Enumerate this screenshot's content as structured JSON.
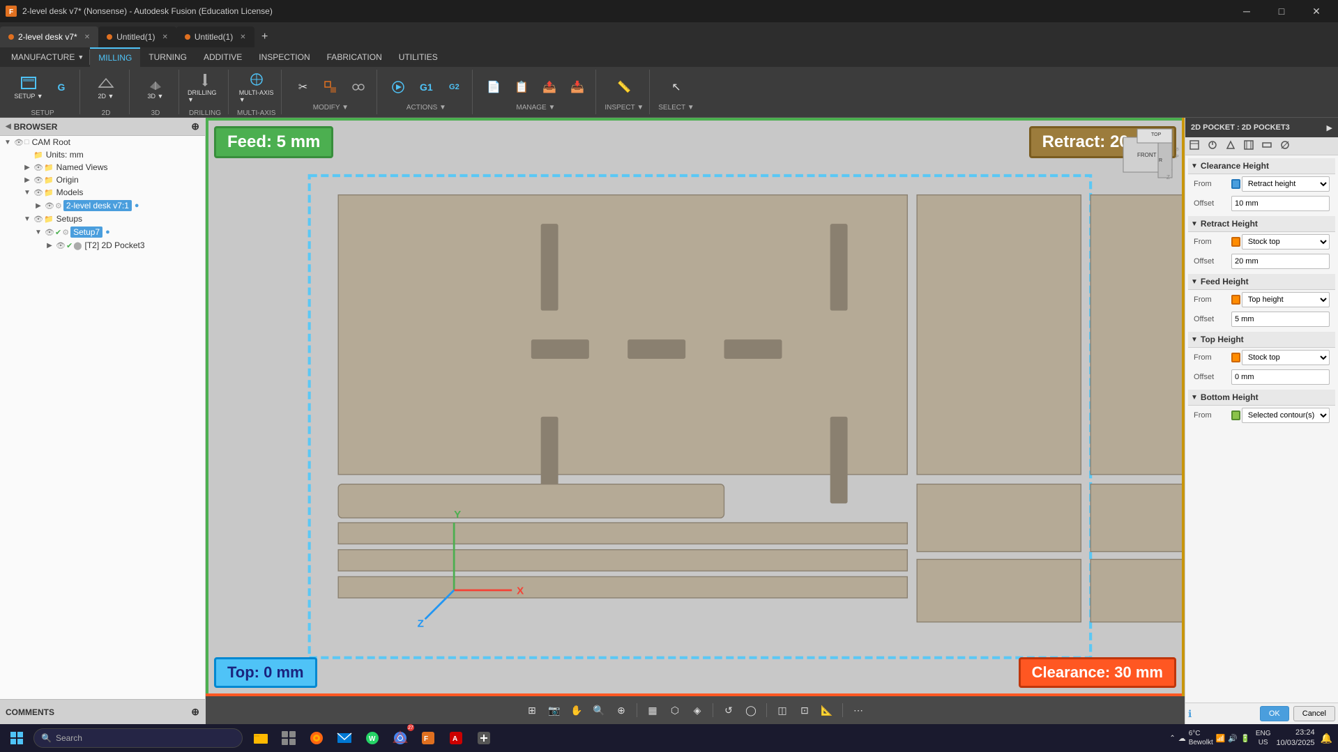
{
  "window": {
    "title": "2-level desk v7* (Nonsense) - Autodesk Fusion (Education License)"
  },
  "tabs": [
    {
      "id": "tab1",
      "label": "2-level desk v7*",
      "active": true,
      "dot": "orange"
    },
    {
      "id": "tab2",
      "label": "Untitled(1)",
      "active": false,
      "dot": "orange"
    },
    {
      "id": "tab3",
      "label": "Untitled(1)",
      "active": false,
      "dot": "orange"
    }
  ],
  "ribbon": {
    "tabs": [
      "MILLING",
      "TURNING",
      "ADDITIVE",
      "INSPECTION",
      "FABRICATION",
      "UTILITIES"
    ],
    "active_tab": "MILLING",
    "groups": [
      {
        "name": "SETUP",
        "label": "SETUP"
      },
      {
        "name": "2D",
        "label": "2D"
      },
      {
        "name": "3D",
        "label": "3D"
      },
      {
        "name": "DRILLING",
        "label": "DRILLING"
      },
      {
        "name": "MULTI-AXIS",
        "label": "MULTI-AXIS"
      },
      {
        "name": "MODIFY",
        "label": "MODIFY"
      },
      {
        "name": "ACTIONS",
        "label": "ACTIONS"
      },
      {
        "name": "MANAGE",
        "label": "MANAGE"
      },
      {
        "name": "INSPECT",
        "label": "INSPECT"
      },
      {
        "name": "SELECT",
        "label": "SELECT"
      }
    ]
  },
  "browser": {
    "title": "BROWSER",
    "items": [
      {
        "id": "cam-root",
        "label": "CAM Root",
        "level": 0,
        "expanded": true,
        "type": "root"
      },
      {
        "id": "units",
        "label": "Units: mm",
        "level": 1,
        "type": "units"
      },
      {
        "id": "named-views",
        "label": "Named Views",
        "level": 1,
        "type": "folder"
      },
      {
        "id": "origin",
        "label": "Origin",
        "level": 1,
        "type": "folder"
      },
      {
        "id": "models",
        "label": "Models",
        "level": 1,
        "expanded": true,
        "type": "folder"
      },
      {
        "id": "desk",
        "label": "2-level desk v7:1",
        "level": 2,
        "type": "model",
        "highlighted": true
      },
      {
        "id": "setups",
        "label": "Setups",
        "level": 1,
        "type": "folder"
      },
      {
        "id": "setup7",
        "label": "Setup7",
        "level": 2,
        "type": "setup",
        "highlighted": true
      },
      {
        "id": "t2pocket3",
        "label": "[T2] 2D Pocket3",
        "level": 3,
        "type": "operation"
      }
    ]
  },
  "viewport": {
    "feed_label": "Feed: 5 mm",
    "retract_label": "Retract: 20 mm",
    "top_label": "Top: 0 mm",
    "clearance_label": "Clearance: 30 mm"
  },
  "right_panel": {
    "title": "2D POCKET : 2D POCKET3",
    "sections": [
      {
        "name": "Clearance Height",
        "fields": [
          {
            "label": "From",
            "type": "select",
            "value": "Retract height",
            "icon": "retract"
          },
          {
            "label": "Offset",
            "type": "input",
            "value": "10 mm"
          }
        ]
      },
      {
        "name": "Retract Height",
        "fields": [
          {
            "label": "From",
            "type": "select",
            "value": "Stock top",
            "icon": "stock"
          },
          {
            "label": "Offset",
            "type": "input",
            "value": "20 mm"
          }
        ]
      },
      {
        "name": "Feed Height",
        "fields": [
          {
            "label": "From",
            "type": "select",
            "value": "Top height",
            "icon": "stock"
          },
          {
            "label": "Offset",
            "type": "input",
            "value": "5 mm"
          }
        ]
      },
      {
        "name": "Top Height",
        "fields": [
          {
            "label": "From",
            "type": "select",
            "value": "Stock top",
            "icon": "stock"
          },
          {
            "label": "Offset",
            "type": "input",
            "value": "0 mm"
          }
        ]
      },
      {
        "name": "Bottom Height",
        "fields": [
          {
            "label": "From",
            "type": "select",
            "value": "Selected contour(s)",
            "icon": "sel"
          }
        ]
      }
    ],
    "buttons": {
      "ok": "OK",
      "cancel": "Cancel"
    }
  },
  "comments": {
    "title": "COMMENTS"
  },
  "taskbar": {
    "search_placeholder": "Search",
    "time": "23:24",
    "date": "10/03/2025",
    "weather_temp": "6°C",
    "weather_desc": "Bewolkt",
    "language": "ENG\nUS"
  }
}
